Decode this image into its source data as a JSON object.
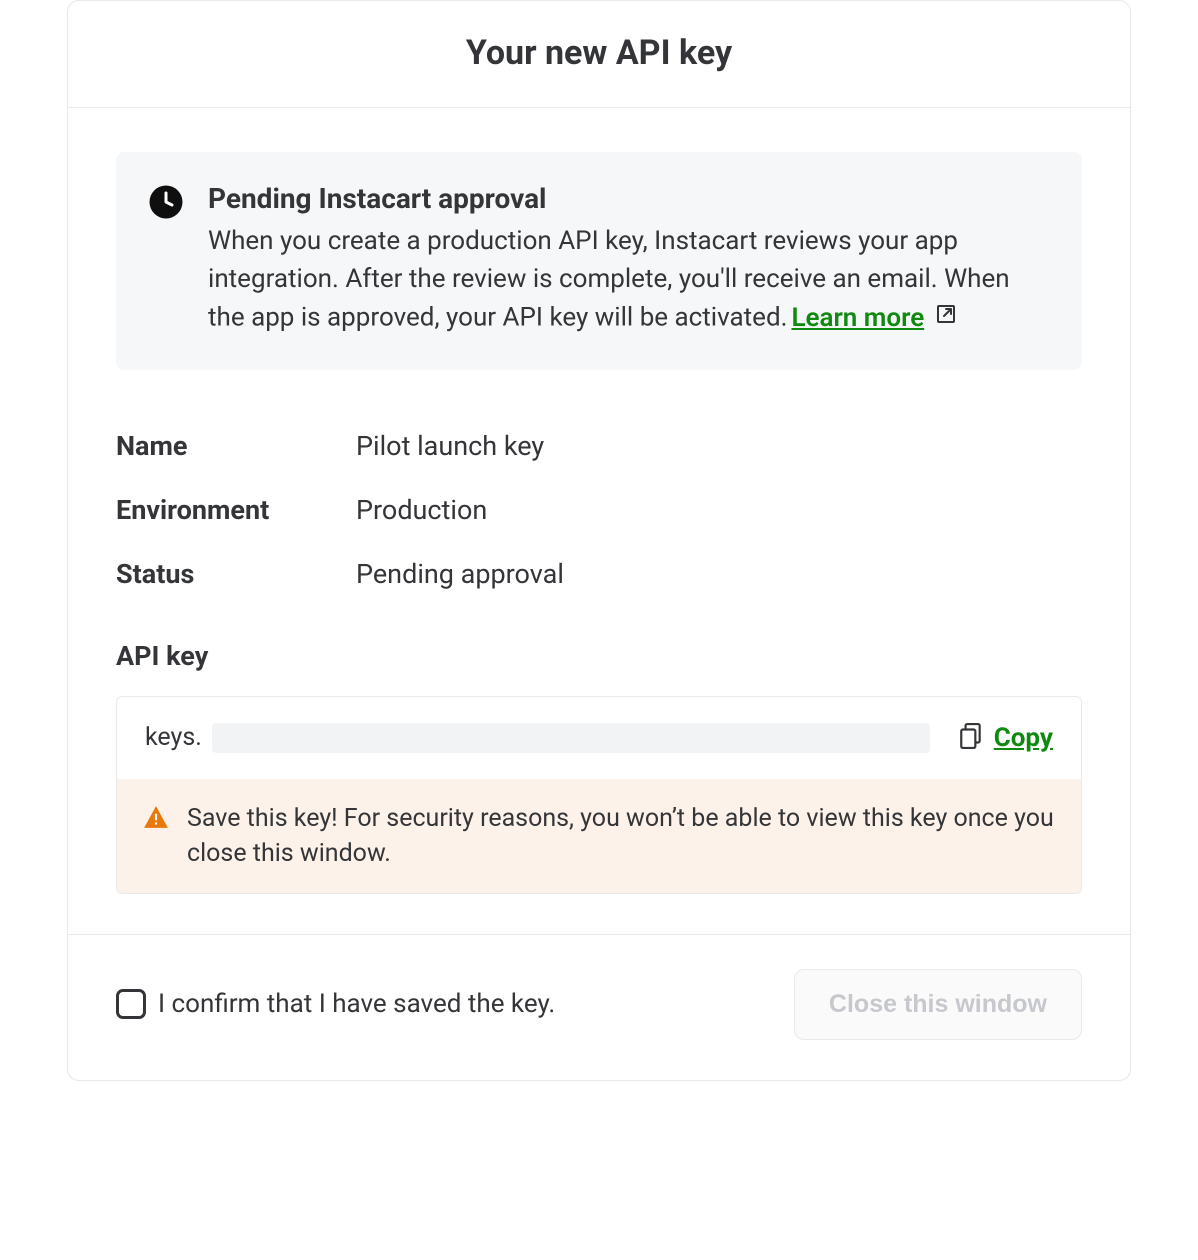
{
  "modal": {
    "title": "Your new API key"
  },
  "banner": {
    "title": "Pending Instacart approval",
    "body": "When you create a production API key, Instacart reviews your app integration. After the review is complete, you'll receive an email. When the app is approved, your API key will be activated.",
    "learn_more": "Learn more"
  },
  "details": {
    "name_label": "Name",
    "name_value": "Pilot launch key",
    "env_label": "Environment",
    "env_value": "Production",
    "status_label": "Status",
    "status_value": "Pending approval"
  },
  "api_key": {
    "label": "API key",
    "prefix": "keys.",
    "copy": "Copy",
    "warning": "Save this key! For security reasons, you won’t be able to view this key once you close this window."
  },
  "footer": {
    "confirm": "I confirm that I have saved the key.",
    "close": "Close this window"
  }
}
